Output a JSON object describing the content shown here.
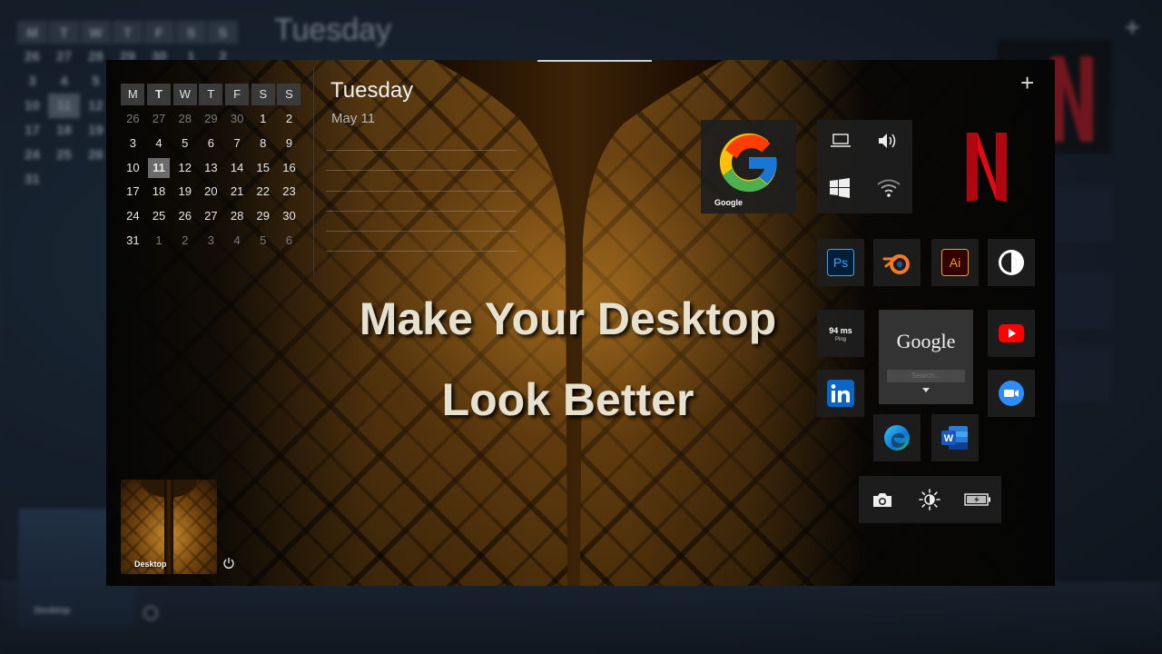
{
  "calendar": {
    "weekday_headers": [
      "M",
      "T",
      "W",
      "T",
      "F",
      "S",
      "S"
    ],
    "weeks": [
      [
        "26",
        "27",
        "28",
        "29",
        "30",
        "1",
        "2"
      ],
      [
        "3",
        "4",
        "5",
        "6",
        "7",
        "8",
        "9"
      ],
      [
        "10",
        "11",
        "12",
        "13",
        "14",
        "15",
        "16"
      ],
      [
        "17",
        "18",
        "19",
        "20",
        "21",
        "22",
        "23"
      ],
      [
        "24",
        "25",
        "26",
        "27",
        "28",
        "29",
        "30"
      ],
      [
        "31",
        "1",
        "2",
        "3",
        "4",
        "5",
        "6"
      ]
    ],
    "today": "11"
  },
  "agenda": {
    "day_name": "Tuesday",
    "date": "May 11"
  },
  "headline": {
    "line1": "Make Your Desktop",
    "line2": "Look Better"
  },
  "desktop_tile": {
    "label": "Desktop"
  },
  "tiles": {
    "google": {
      "label": "Google",
      "icon": "google-g-icon"
    },
    "system": [
      "laptop-icon",
      "volume-icon",
      "windows-icon",
      "wifi-icon"
    ],
    "netflix": {
      "icon": "netflix-icon",
      "color": "#E50914"
    },
    "apps_row": [
      "photoshop-icon",
      "blender-icon",
      "illustrator-icon",
      "contrast-icon"
    ],
    "ping": {
      "value": "94 ms",
      "label": "Ping"
    },
    "google_search": {
      "logo": "Google",
      "placeholder": "Search..."
    },
    "youtube": {
      "icon": "youtube-icon",
      "color": "#FF0000"
    },
    "linkedin": {
      "icon": "linkedin-icon",
      "color": "#0A66C2"
    },
    "zoom": {
      "icon": "zoom-icon",
      "color": "#2D8CFF"
    },
    "edge": {
      "icon": "edge-icon"
    },
    "word": {
      "icon": "word-icon",
      "color": "#185ABD"
    },
    "quick_bar": [
      "camera-icon",
      "brightness-icon",
      "battery-icon"
    ]
  },
  "colors": {
    "accent_photoshop": "#31A8FF",
    "accent_illustrator": "#FF9A00",
    "accent_blender": "#F5792A"
  }
}
